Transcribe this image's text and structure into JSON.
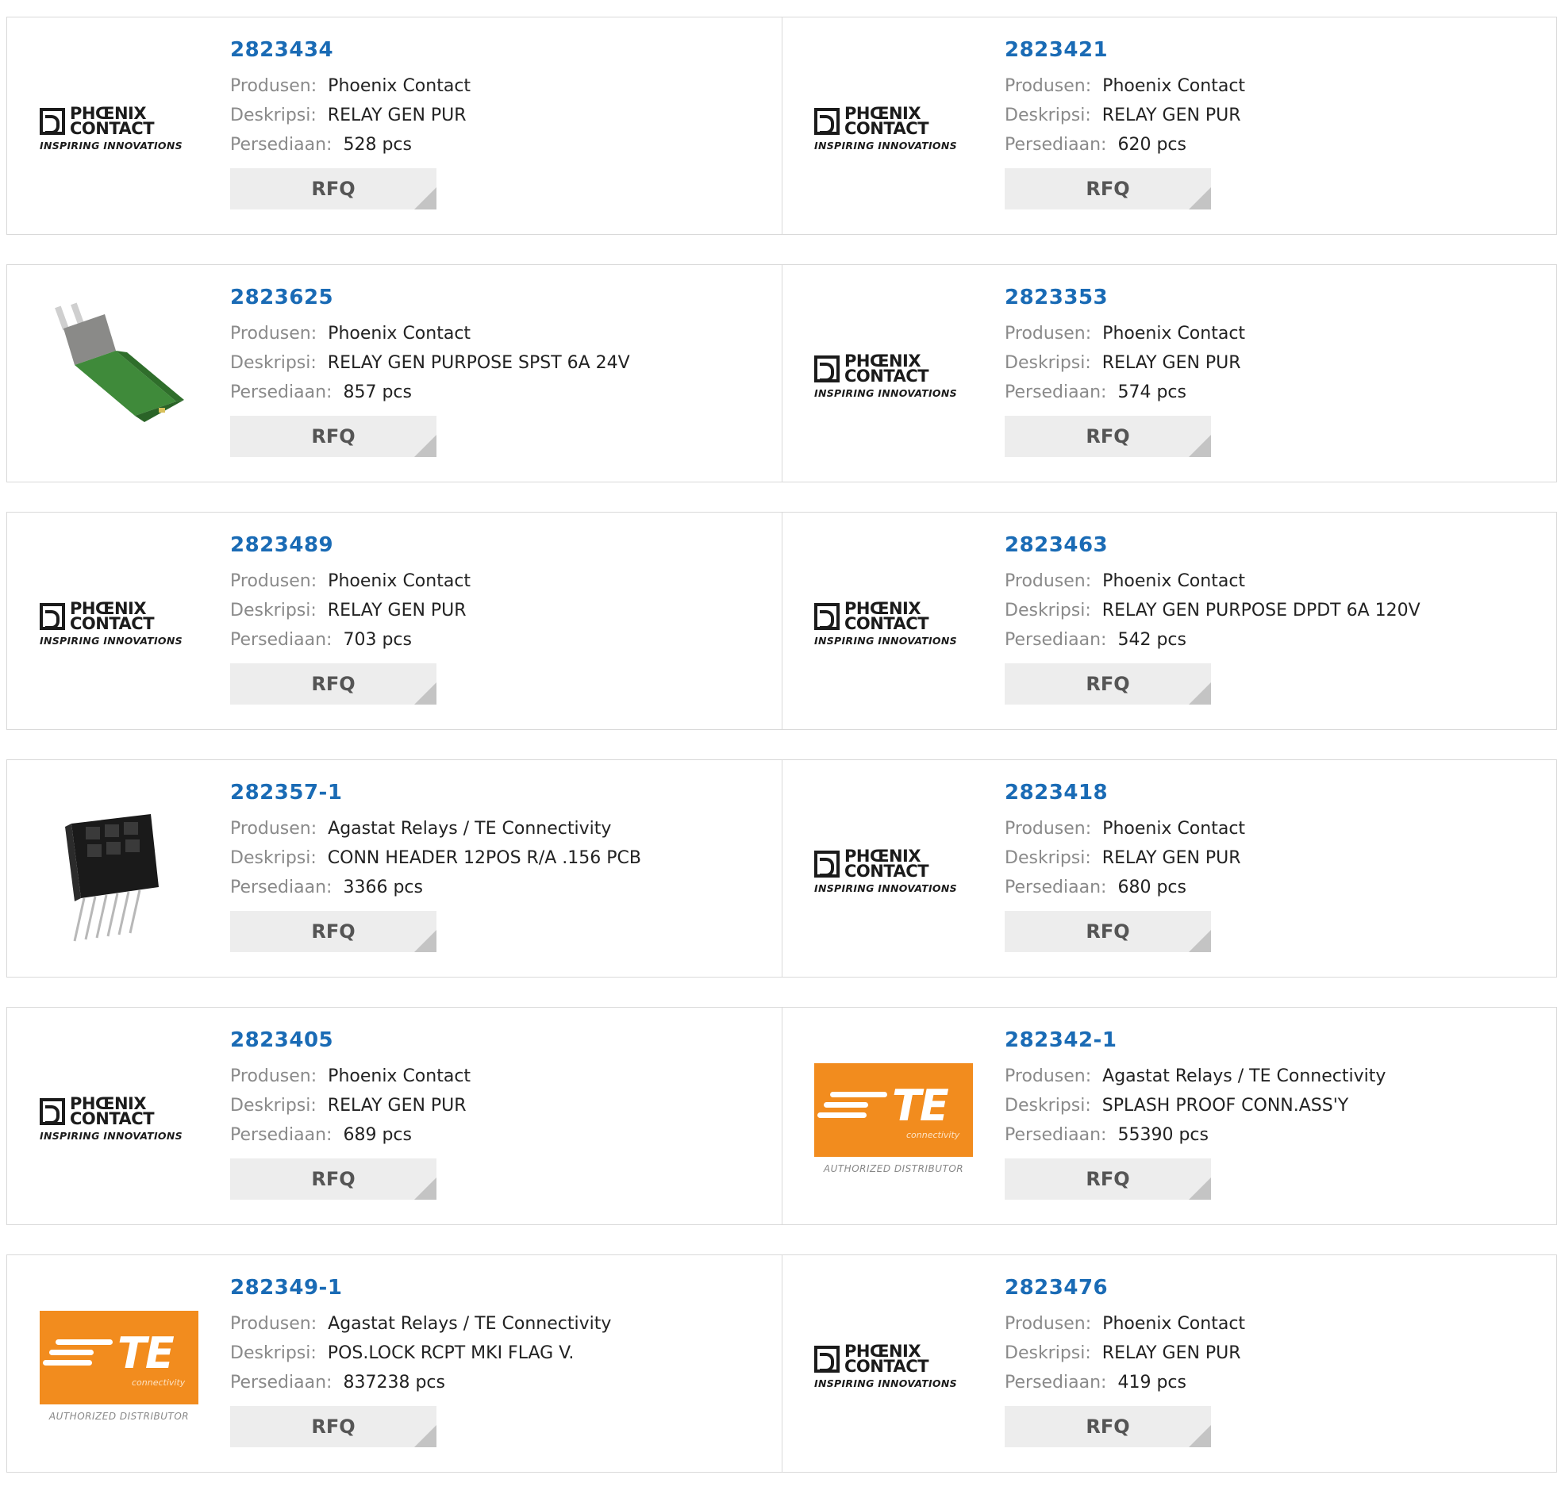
{
  "labels": {
    "manufacturer": "Produsen:",
    "description": "Deskripsi:",
    "stock": "Persediaan:",
    "rfq": "RFQ"
  },
  "logos": {
    "phoenix": {
      "line1": "PHŒNIX",
      "line2": "CONTACT",
      "tagline": "INSPIRING INNOVATIONS"
    },
    "te": {
      "letters": "TE",
      "sub": "connectivity",
      "tagline": "AUTHORIZED DISTRIBUTOR"
    }
  },
  "products": [
    {
      "part": "2823434",
      "manufacturer": "Phoenix Contact",
      "description": "RELAY GEN PUR",
      "stock": "528 pcs",
      "image": "phoenix-logo"
    },
    {
      "part": "2823421",
      "manufacturer": "Phoenix Contact",
      "description": "RELAY GEN PUR",
      "stock": "620 pcs",
      "image": "phoenix-logo"
    },
    {
      "part": "2823625",
      "manufacturer": "Phoenix Contact",
      "description": "RELAY GEN PURPOSE SPST 6A 24V",
      "stock": "857 pcs",
      "image": "green-relay-photo"
    },
    {
      "part": "2823353",
      "manufacturer": "Phoenix Contact",
      "description": "RELAY GEN PUR",
      "stock": "574 pcs",
      "image": "phoenix-logo"
    },
    {
      "part": "2823489",
      "manufacturer": "Phoenix Contact",
      "description": "RELAY GEN PUR",
      "stock": "703 pcs",
      "image": "phoenix-logo"
    },
    {
      "part": "2823463",
      "manufacturer": "Phoenix Contact",
      "description": "RELAY GEN PURPOSE DPDT 6A 120V",
      "stock": "542 pcs",
      "image": "phoenix-logo"
    },
    {
      "part": "282357-1",
      "manufacturer": "Agastat Relays / TE Connectivity",
      "description": "CONN HEADER 12POS R/A .156 PCB",
      "stock": "3366 pcs",
      "image": "header-connector-photo"
    },
    {
      "part": "2823418",
      "manufacturer": "Phoenix Contact",
      "description": "RELAY GEN PUR",
      "stock": "680 pcs",
      "image": "phoenix-logo"
    },
    {
      "part": "2823405",
      "manufacturer": "Phoenix Contact",
      "description": "RELAY GEN PUR",
      "stock": "689 pcs",
      "image": "phoenix-logo"
    },
    {
      "part": "282342-1",
      "manufacturer": "Agastat Relays / TE Connectivity",
      "description": "SPLASH PROOF CONN.ASS'Y",
      "stock": "55390 pcs",
      "image": "te-logo"
    },
    {
      "part": "282349-1",
      "manufacturer": "Agastat Relays / TE Connectivity",
      "description": "POS.LOCK RCPT MKI FLAG V.",
      "stock": "837238 pcs",
      "image": "te-logo"
    },
    {
      "part": "2823476",
      "manufacturer": "Phoenix Contact",
      "description": "RELAY GEN PUR",
      "stock": "419 pcs",
      "image": "phoenix-logo"
    }
  ],
  "colors": {
    "part_link": "#1a6bb5",
    "label_gray": "#8a8a8a",
    "rfq_bg": "#ededed",
    "te_orange": "#f28c1e",
    "relay_green": "#3f8a3a"
  }
}
